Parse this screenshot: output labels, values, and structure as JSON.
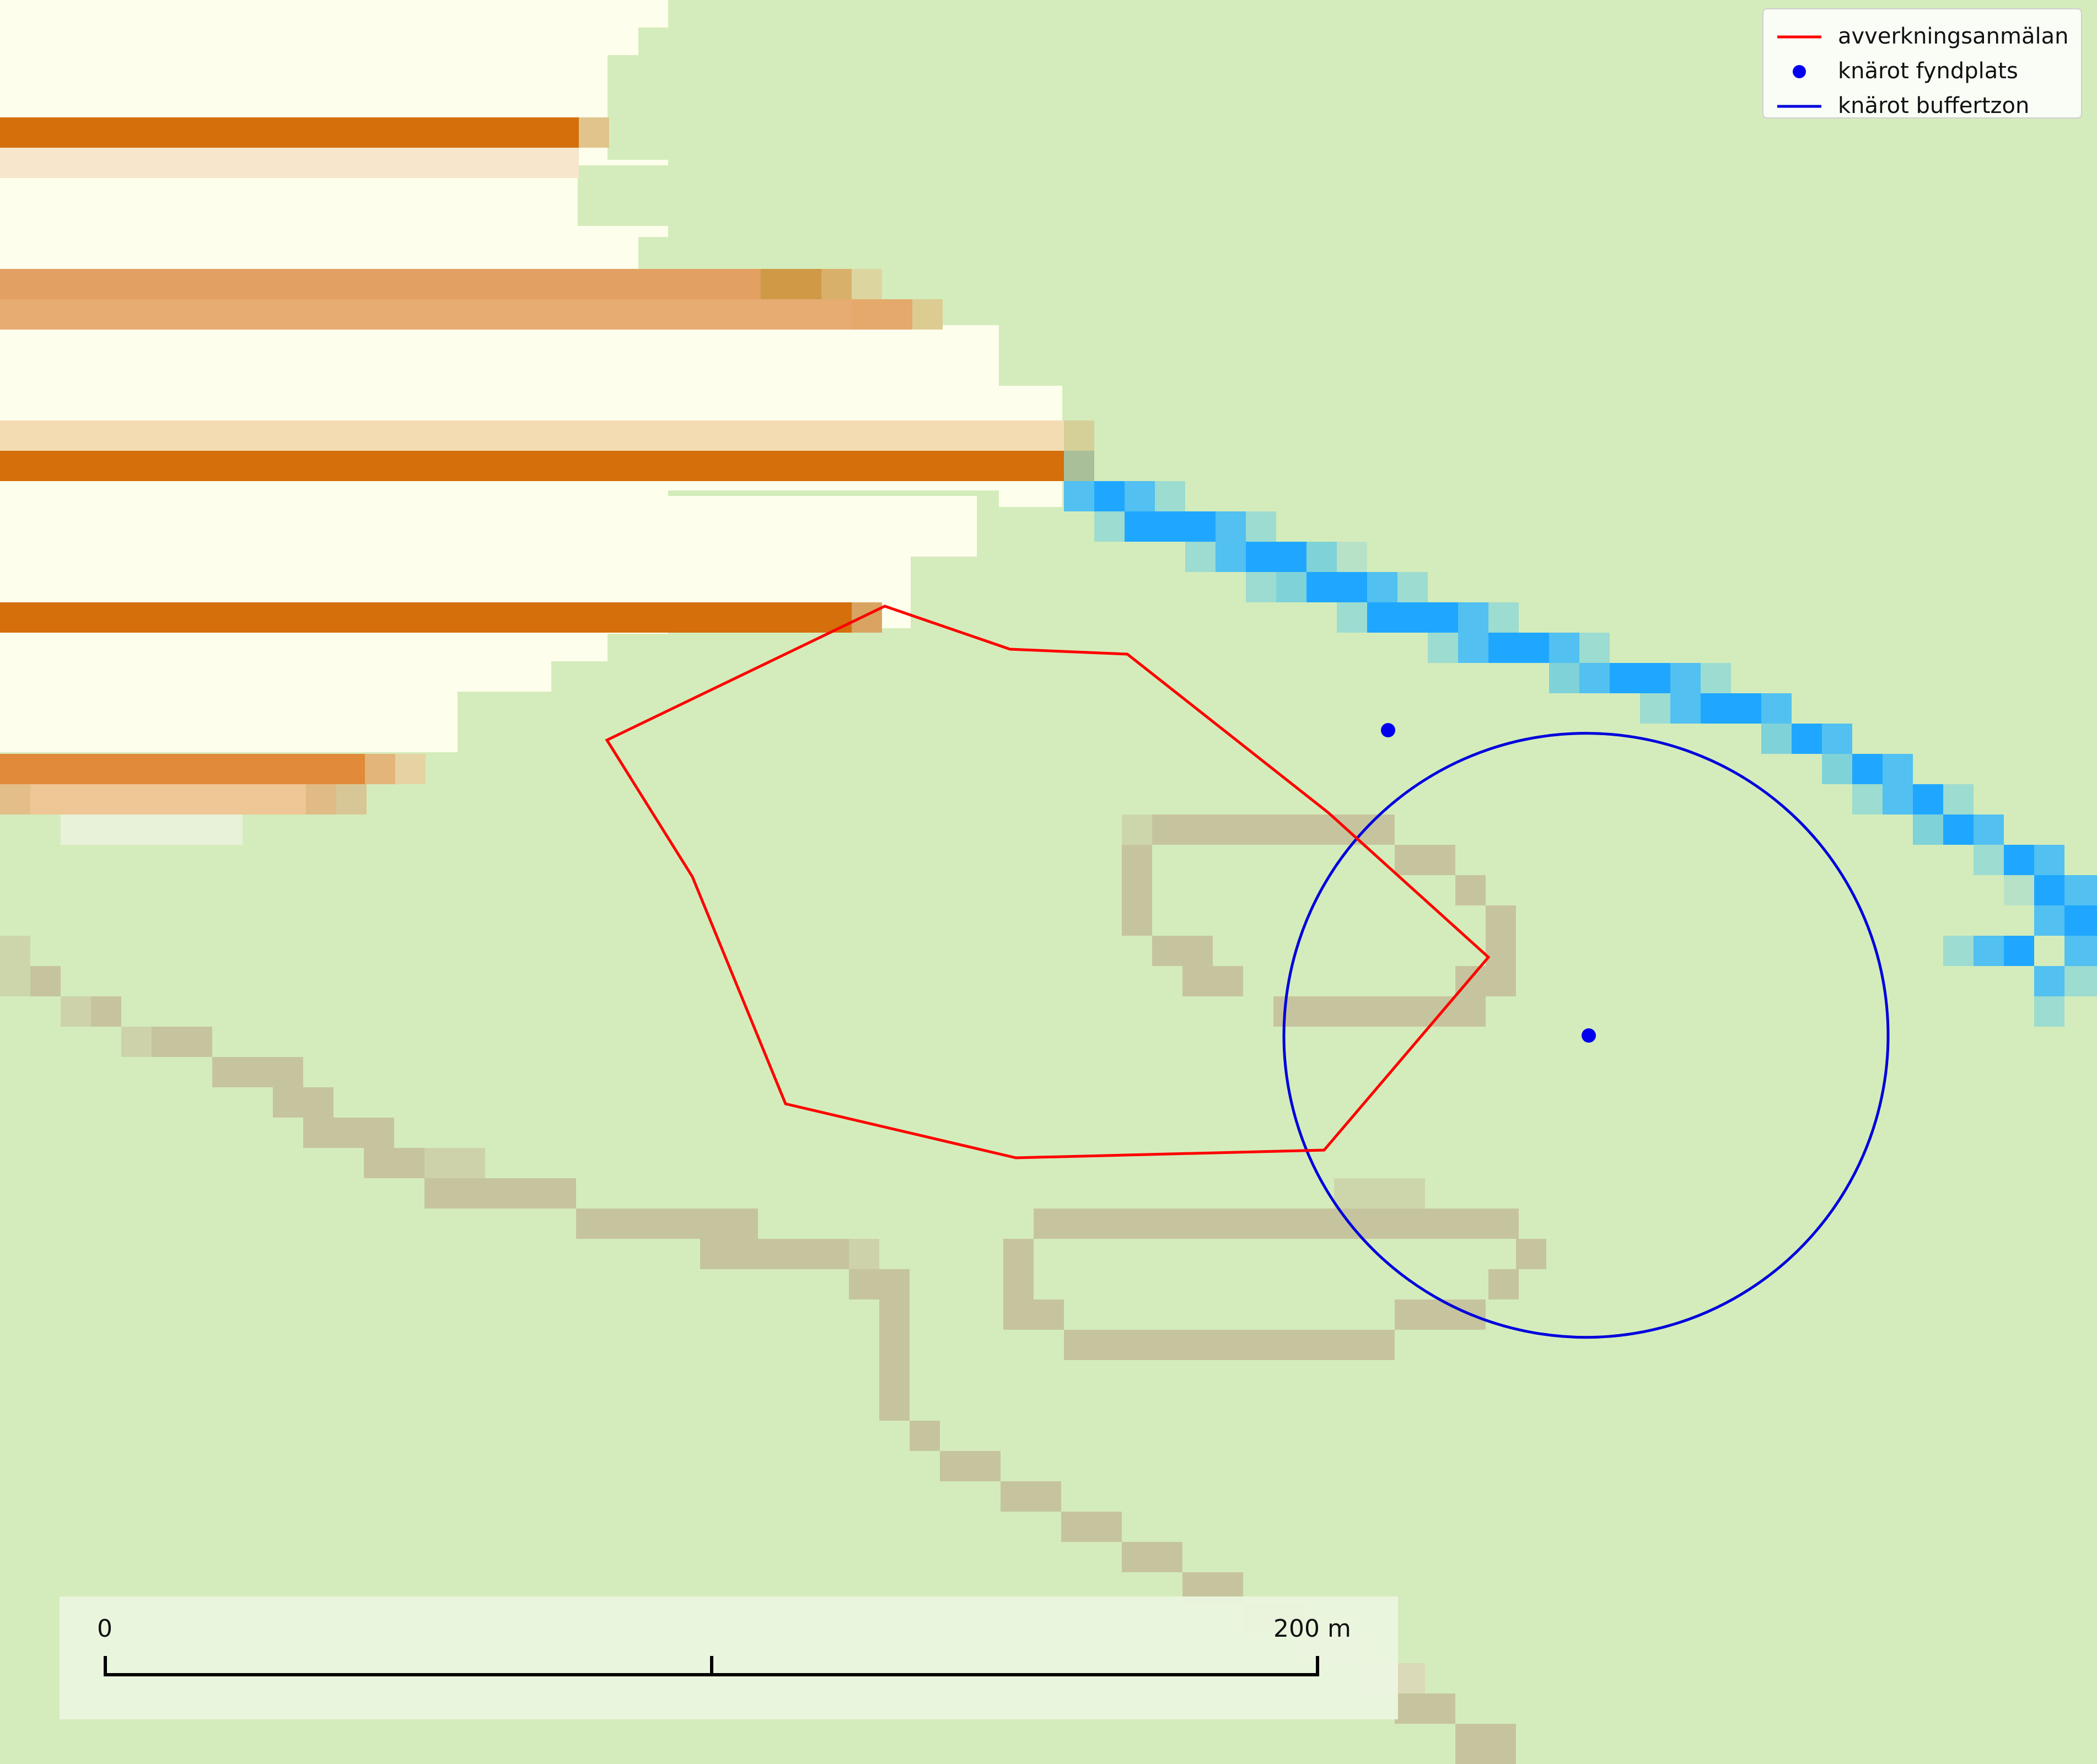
{
  "legend": {
    "items": [
      {
        "label": "avverkningsanmälan",
        "symbol": "line",
        "color": "#ff0000"
      },
      {
        "label": "knärot fyndplats",
        "symbol": "point",
        "color": "#0000ee"
      },
      {
        "label": "knärot buffertzon",
        "symbol": "line",
        "color": "#0000dd"
      }
    ]
  },
  "scalebar": {
    "start_label": "0",
    "end_label": "200 m",
    "length_m": 200
  },
  "colors": {
    "background_forest": "#d4ecbb",
    "open_land": "#fefeec",
    "orange_strip": "#d46f0c",
    "road": "#c6c49e",
    "water": "#1fa7ff",
    "logging_notice": "#ff0000",
    "buffer_zone": "#0000dd",
    "find_site": "#0000ee"
  }
}
